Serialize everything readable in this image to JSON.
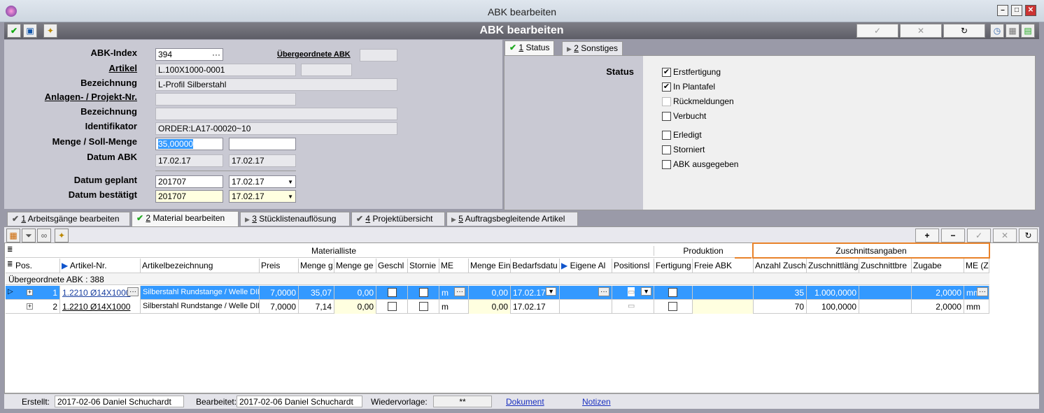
{
  "window": {
    "title": "ABK bearbeiten"
  },
  "header": {
    "title": "ABK bearbeiten"
  },
  "form": {
    "abk_index_label": "ABK-Index",
    "abk_index": "394",
    "uebergeordnete_label": "Übergeordnete ABK",
    "artikel_label": "Artikel",
    "artikel": "L.100X1000-0001",
    "bezeichnung_label": "Bezeichnung",
    "bezeichnung": "L-Profil Silberstahl",
    "anlagen_label": "Anlagen- / Projekt-Nr.",
    "bezeichnung2_label": "Bezeichnung",
    "identifikator_label": "Identifikator",
    "identifikator": "ORDER:LA17-00020~10",
    "menge_label": "Menge / Soll-Menge",
    "menge": "35,00000",
    "datum_abk_label": "Datum ABK",
    "datum_abk_1": "17.02.17",
    "datum_abk_2": "17.02.17",
    "datum_geplant_label": "Datum geplant",
    "datum_geplant_1": "201707",
    "datum_geplant_2": "17.02.17",
    "datum_bestaetigt_label": "Datum bestätigt",
    "datum_bestaetigt_1": "201707",
    "datum_bestaetigt_2": "17.02.17"
  },
  "status_tabs": [
    {
      "num": "1",
      "label": "Status"
    },
    {
      "num": "2",
      "label": "Sonstiges"
    }
  ],
  "status": {
    "label": "Status",
    "items": [
      {
        "label": "Erstfertigung",
        "checked": true,
        "disabled": false
      },
      {
        "label": "In Plantafel",
        "checked": true,
        "disabled": false
      },
      {
        "label": "Rückmeldungen",
        "checked": false,
        "disabled": true
      },
      {
        "label": "Verbucht",
        "checked": false,
        "disabled": false
      },
      {
        "label": "Erledigt",
        "checked": false,
        "disabled": false
      },
      {
        "label": "Storniert",
        "checked": false,
        "disabled": false
      },
      {
        "label": "ABK ausgegeben",
        "checked": false,
        "disabled": false
      }
    ]
  },
  "lower_tabs": [
    {
      "num": "1",
      "label": "Arbeitsgänge bearbeiten",
      "icon": "check"
    },
    {
      "num": "2",
      "label": "Material bearbeiten",
      "icon": "check"
    },
    {
      "num": "3",
      "label": "Stücklistenauflösung",
      "icon": "play"
    },
    {
      "num": "4",
      "label": "Projektübersicht",
      "icon": "check"
    },
    {
      "num": "5",
      "label": "Auftragsbegleitende Artikel",
      "icon": "play"
    }
  ],
  "grid": {
    "group_materialliste": "Materialliste",
    "group_produktion": "Produktion",
    "group_zuschnitt": "Zuschnittsangaben",
    "badge": "1",
    "columns": [
      "Pos.",
      "Artikel-Nr.",
      "Artikelbezeichnung",
      "Preis",
      "Menge g",
      "Menge ge",
      "Geschl",
      "Stornie",
      "ME",
      "Menge Ein",
      "Bedarfsdatu",
      "Eigene Al",
      "Positionsl",
      "Fertigung",
      "Freie ABK",
      "Anzahl Zusch",
      "Zuschnittläng",
      "Zuschnittbre",
      "Zugabe",
      "ME (Z"
    ],
    "group_row": "Übergeordnete ABK : 388",
    "rows": [
      {
        "pos": "1",
        "artikel": "1.2210 Ø14X1000",
        "bez": "Silberstahl Rundstange / Welle DIN",
        "preis": "7,0000",
        "menge_g": "35,07",
        "menge_ge": "0,00",
        "me": "m",
        "menge_ein": "0,00",
        "bedarf": "17.02.17",
        "anzahl": "35",
        "laenge": "1.000,0000",
        "zugabe": "2,0000",
        "me_z": "mm"
      },
      {
        "pos": "2",
        "artikel": "1.2210 Ø14X1000",
        "bez": "Silberstahl Rundstange / Welle DIN",
        "preis": "7,0000",
        "menge_g": "7,14",
        "menge_ge": "0,00",
        "me": "m",
        "menge_ein": "0,00",
        "bedarf": "17.02.17",
        "anzahl": "70",
        "laenge": "100,0000",
        "zugabe": "2,0000",
        "me_z": "mm"
      }
    ]
  },
  "footer": {
    "erstellt_label": "Erstellt:",
    "erstellt": "2017-02-06  Daniel Schuchardt",
    "bearbeitet_label": "Bearbeitet:",
    "bearbeitet": "2017-02-06  Daniel Schuchardt",
    "wiedervorlage_label": "Wiedervorlage:",
    "wiedervorlage": "**",
    "dokument": "Dokument",
    "notizen": "Notizen"
  }
}
